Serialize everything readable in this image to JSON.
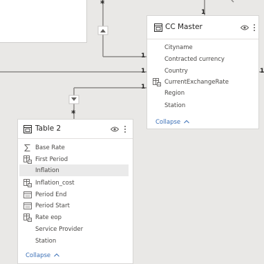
{
  "relationships": {
    "top_many": "*",
    "one_top": "1",
    "one_a": "1",
    "one_b": "1",
    "one_c": "1",
    "one_d": "1",
    "one_right": "1",
    "bottom_many": "*"
  },
  "cc_master": {
    "title": "CC Master",
    "fields": [
      "Cityname",
      "Contracted currency",
      "Country",
      "CurrentExchangeRate",
      "Region",
      "Station"
    ],
    "collapse_label": "Collapse"
  },
  "table2": {
    "title": "Table 2",
    "fields": [
      "Base Rate",
      "First Period",
      "Inflation",
      "Inflation_cost",
      "Period End",
      "Period Start",
      "Rate eop",
      "Service Provider",
      "Station"
    ],
    "collapse_label": "Collapse"
  },
  "colors": {
    "canvas": "#e9e8e6",
    "line": "#8a8886",
    "link": "#3a6fb6"
  }
}
